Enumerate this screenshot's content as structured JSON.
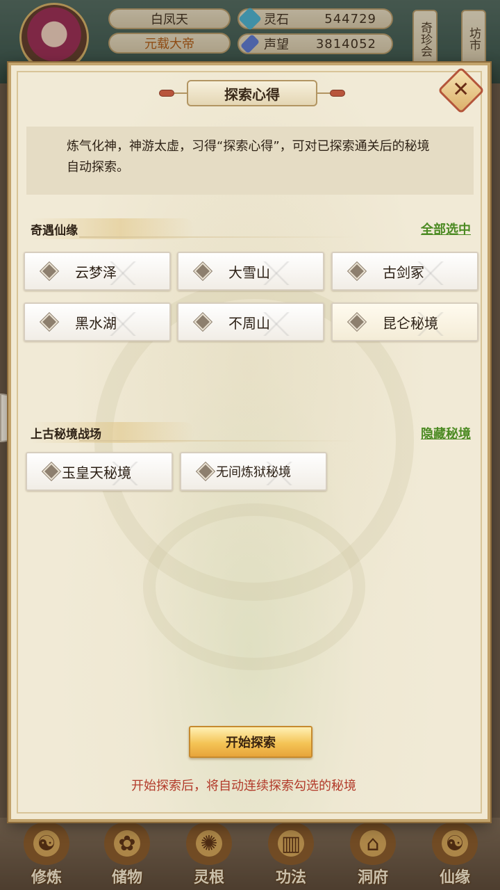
{
  "hud": {
    "player_name": "白凤天",
    "player_title": "元载大帝",
    "resources": [
      {
        "label": "灵石",
        "value": "544729",
        "icon": "spirit-stone-icon",
        "color": "#49b6d8"
      },
      {
        "label": "声望",
        "value": "3814052",
        "icon": "reputation-icon",
        "color": "#5a7ad8"
      }
    ],
    "side_tabs": [
      "奇珍会",
      "坊市"
    ]
  },
  "dialog": {
    "title": "探索心得",
    "close_icon": "✕",
    "description": "炼气化神，神游太虚，习得“探索心得”，可对已探索通关后的秘境自动探索。",
    "section1": {
      "heading": "奇遇仙缘",
      "link": "全部选中",
      "options": [
        {
          "label": "云梦泽"
        },
        {
          "label": "大雪山"
        },
        {
          "label": "古剑冢"
        },
        {
          "label": "黑水湖"
        },
        {
          "label": "不周山"
        },
        {
          "label": "昆仑秘境"
        }
      ]
    },
    "section2": {
      "heading": "上古秘境战场",
      "link": "隐藏秘境",
      "options": [
        {
          "label": "玉皇天秘境"
        },
        {
          "label": "无间炼狱秘境"
        }
      ]
    },
    "start_button": "开始探索",
    "hint": "开始探索后，将自动连续探索勾选的秘境"
  },
  "bottom_nav": [
    {
      "label": "修炼",
      "icon": "cultivation-icon"
    },
    {
      "label": "储物",
      "icon": "storage-bag-icon"
    },
    {
      "label": "灵根",
      "icon": "spirit-root-icon"
    },
    {
      "label": "功法",
      "icon": "technique-book-icon"
    },
    {
      "label": "洞府",
      "icon": "cave-dwelling-icon"
    },
    {
      "label": "仙缘",
      "icon": "immortal-fate-icon"
    }
  ]
}
